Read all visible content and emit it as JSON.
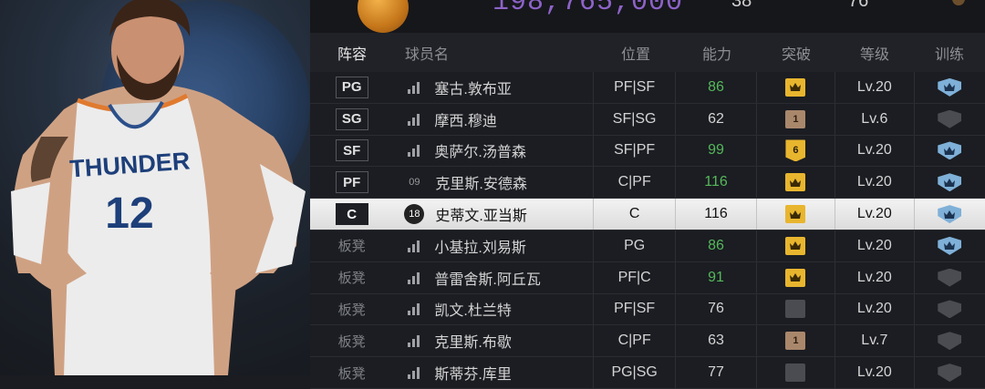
{
  "top": {
    "money": "198,765,000",
    "stat_a": "38",
    "stat_b": "76"
  },
  "colors": {
    "accent_green": "#55b85a",
    "gold": "#e8b52e",
    "blue_train": "#7fb0d8",
    "money_purple": "#8d63c8"
  },
  "header": {
    "lineup": "阵容",
    "name": "球员名",
    "position": "位置",
    "ability": "能力",
    "breakthrough": "突破",
    "level": "等级",
    "training": "训练"
  },
  "rows": [
    {
      "slot": "PG",
      "jersey": "",
      "name": "塞古.敦布亚",
      "position": "PF|SF",
      "ability": "86",
      "breakthrough": "crown",
      "level": "Lv.20",
      "training": "blue"
    },
    {
      "slot": "SG",
      "jersey": "",
      "name": "摩西.穆迪",
      "position": "SF|SG",
      "ability": "62",
      "breakthrough": "1",
      "level": "Lv.6",
      "training": "gray"
    },
    {
      "slot": "SF",
      "jersey": "",
      "name": "奥萨尔.汤普森",
      "position": "SF|PF",
      "ability": "99",
      "breakthrough": "6",
      "level": "Lv.20",
      "training": "blue"
    },
    {
      "slot": "PF",
      "jersey": "09",
      "name": "克里斯.安德森",
      "position": "C|PF",
      "ability": "116",
      "breakthrough": "crown",
      "level": "Lv.20",
      "training": "blue"
    },
    {
      "slot": "C",
      "jersey": "18",
      "name": "史蒂文.亚当斯",
      "position": "C",
      "ability": "116",
      "breakthrough": "crown",
      "level": "Lv.20",
      "training": "blue"
    },
    {
      "slot": "板凳",
      "jersey": "",
      "name": "小基拉.刘易斯",
      "position": "PG",
      "ability": "86",
      "breakthrough": "crown",
      "level": "Lv.20",
      "training": "blue"
    },
    {
      "slot": "板凳",
      "jersey": "",
      "name": "普雷舍斯.阿丘瓦",
      "position": "PF|C",
      "ability": "91",
      "breakthrough": "crown",
      "level": "Lv.20",
      "training": "gray"
    },
    {
      "slot": "板凳",
      "jersey": "",
      "name": "凯文.杜兰特",
      "position": "PF|SF",
      "ability": "76",
      "breakthrough": "gray",
      "level": "Lv.20",
      "training": "gray"
    },
    {
      "slot": "板凳",
      "jersey": "",
      "name": "克里斯.布歇",
      "position": "C|PF",
      "ability": "63",
      "breakthrough": "1",
      "level": "Lv.7",
      "training": "gray"
    },
    {
      "slot": "板凳",
      "jersey": "",
      "name": "斯蒂芬.库里",
      "position": "PG|SG",
      "ability": "77",
      "breakthrough": "gray",
      "level": "Lv.20",
      "training": "gray"
    }
  ],
  "player_card": {
    "team_text": "THUNDER",
    "jersey_number": "12"
  }
}
